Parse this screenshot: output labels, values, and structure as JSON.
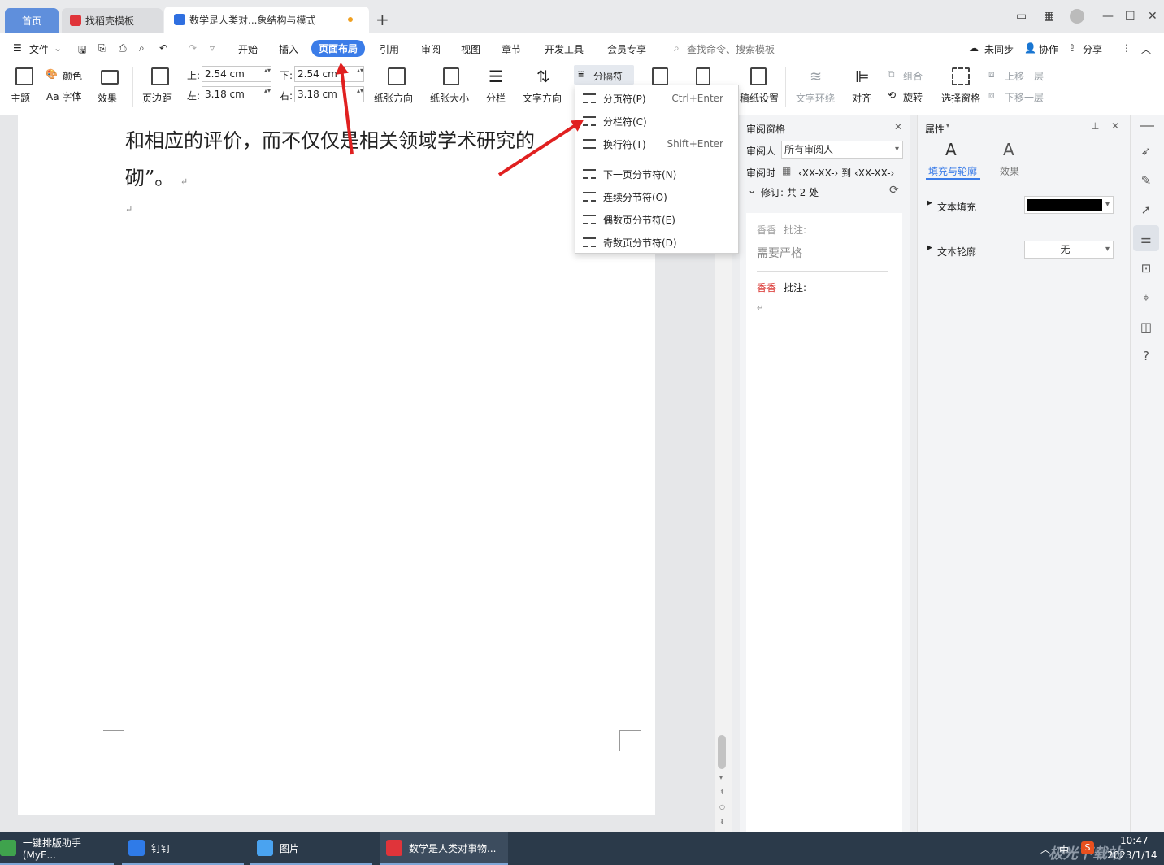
{
  "titlebar": {
    "tab_home": "首页",
    "tab_template": "找稻壳模板",
    "tab_doc": "数学是人类对...象结构与模式",
    "new_tab": "+"
  },
  "menu": {
    "file": "文件",
    "items": [
      "开始",
      "插入",
      "页面布局",
      "引用",
      "审阅",
      "视图",
      "章节",
      "开发工具",
      "会员专享"
    ],
    "search_placeholder": "查找命令、搜索模板",
    "unsync": "未同步",
    "collab": "协作",
    "share": "分享"
  },
  "ribbon": {
    "theme": "主题",
    "color": "颜色",
    "font": "Aa 字体",
    "effect": "效果",
    "margin": "页边距",
    "top_label": "上:",
    "top_value": "2.54 cm",
    "bottom_label": "下:",
    "bottom_value": "2.54 cm",
    "left_label": "左:",
    "left_value": "3.18 cm",
    "right_label": "右:",
    "right_value": "3.18 cm",
    "orientation": "纸张方向",
    "size": "纸张大小",
    "columns": "分栏",
    "text_dir": "文字方向",
    "separator": "分隔符",
    "draft": "稿纸设置",
    "wrap": "文字环绕",
    "align": "对齐",
    "group": "组合",
    "rotate": "旋转",
    "select_pane": "选择窗格",
    "up_layer": "上移一层",
    "down_layer": "下移一层"
  },
  "dropdown": {
    "items": [
      {
        "label": "分页符(P)",
        "shortcut": "Ctrl+Enter"
      },
      {
        "label": "分栏符(C)",
        "shortcut": ""
      },
      {
        "label": "换行符(T)",
        "shortcut": "Shift+Enter"
      },
      {
        "label": "下一页分节符(N)",
        "shortcut": ""
      },
      {
        "label": "连续分节符(O)",
        "shortcut": ""
      },
      {
        "label": "偶数页分节符(E)",
        "shortcut": ""
      },
      {
        "label": "奇数页分节符(D)",
        "shortcut": ""
      }
    ]
  },
  "document": {
    "line1": "和相应的评价，而不仅仅是相关领域学术研究的",
    "line2": "砌”。",
    "para_mark": "↵"
  },
  "review": {
    "title": "审阅窗格",
    "reviewer_label": "审阅人",
    "reviewer_value": "所有审阅人",
    "time_label": "审阅时",
    "time_range": "‹XX-XX-› 到 ‹XX-XX-›",
    "revisions": "修订:  共 2 处",
    "c1_author": "香香",
    "c1_label": "批注:",
    "c1_text": "需要严格",
    "c2_author": "香香",
    "c2_label": "批注:",
    "c2_text": "↵"
  },
  "props": {
    "title": "属性",
    "tab_fill": "填充与轮廓",
    "tab_effect": "效果",
    "text_fill": "文本填充",
    "text_outline": "文本轮廓",
    "outline_value": "无",
    "fill_color": "#000000"
  },
  "taskbar": {
    "items": [
      "一键排版助手(MyE...",
      "钉钉",
      "图片",
      "数学是人类对事物..."
    ],
    "time": "10:47",
    "date": "2023/1/14",
    "ime": "中",
    "watermark": "极光下载站"
  },
  "colors": {
    "accent": "#3b7ce8",
    "arrow": "#e02020",
    "comment_author2": "#d9302c"
  }
}
